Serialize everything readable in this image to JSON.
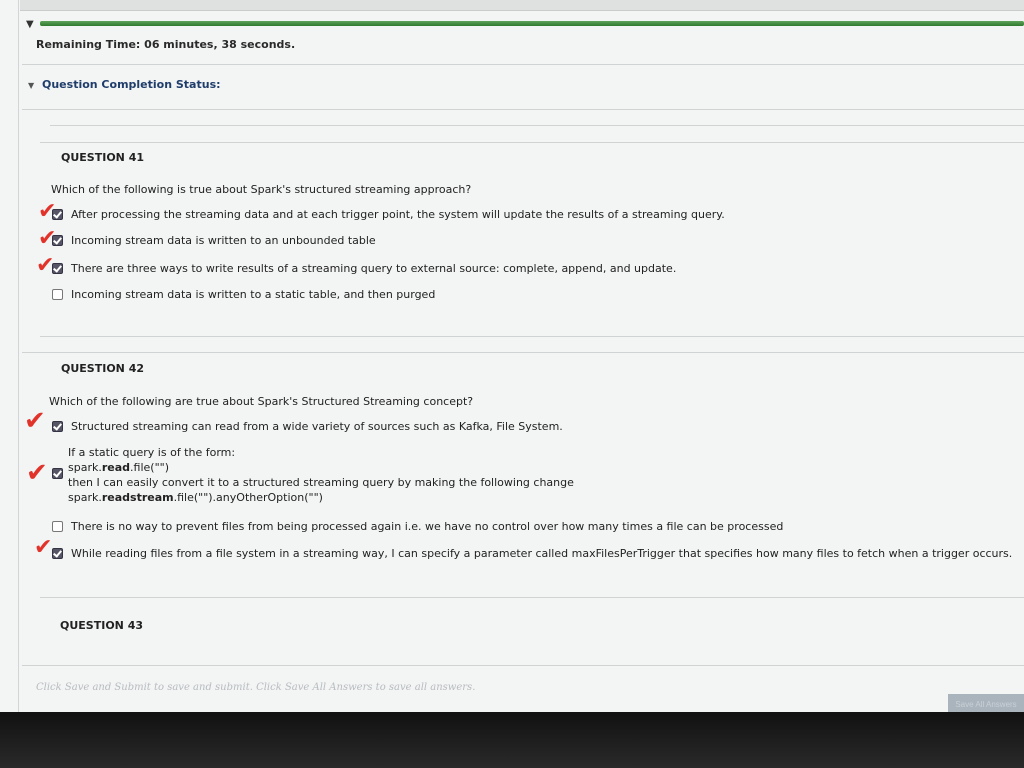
{
  "header": {
    "collapse_icon": "triangle-down-icon",
    "timer_label": "Remaining Time:",
    "timer_value": "06 minutes, 38 seconds.",
    "status_label": "Question Completion Status:"
  },
  "progress_fraction": 1.0,
  "questions": [
    {
      "title": "QUESTION 41",
      "text": "Which of the following is true about Spark's structured streaming approach?",
      "options": [
        {
          "label": "After processing the streaming data and at each trigger point, the system will update the results of a streaming query.",
          "checked": true
        },
        {
          "label": "Incoming stream data is written to an unbounded table",
          "checked": true
        },
        {
          "label": "There are three ways to write results of a streaming query to external source: complete, append, and update.",
          "checked": true
        },
        {
          "label": "Incoming stream data is written to a static table, and then purged",
          "checked": false
        }
      ]
    },
    {
      "title": "QUESTION 42",
      "text": "Which of the following are true about Spark's Structured Streaming concept?",
      "options": [
        {
          "label": "Structured streaming can read from a wide variety of sources such as Kafka, File System.",
          "checked": true
        },
        {
          "lines": [
            "If a static query is of the form:",
            "spark.read.file(\"\")",
            "then I can easily convert it to a structured streaming query by making the following change",
            "spark.readstream.file(\"\").anyOtherOption(\"\")"
          ],
          "checked": true
        },
        {
          "label": "There is no way to prevent files from being processed again i.e. we have no control over how many times a file can be processed",
          "checked": false
        },
        {
          "label": "While reading files from a file system in a streaming way, I can specify a parameter called maxFilesPerTrigger that specifies how many files to fetch when a trigger occurs.",
          "checked": true
        }
      ]
    },
    {
      "title": "QUESTION 43"
    }
  ],
  "footer": {
    "instructions": "Click Save and Submit to save and submit. Click Save All Answers to save all answers.",
    "save_all_label": "Save All Answers"
  },
  "annotations": {
    "mark_color": "#e2332b",
    "mark_glyph": "✔"
  }
}
